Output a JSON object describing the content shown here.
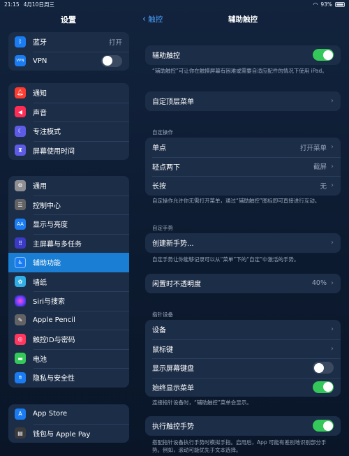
{
  "status": {
    "time": "21:15",
    "date": "4月10日周三",
    "battery": "93%"
  },
  "sidebar": {
    "title": "设置",
    "group1": [
      {
        "label": "蓝牙",
        "value": "打开",
        "icon": "bluetooth-icon",
        "color": "#1a7cf2"
      },
      {
        "label": "VPN",
        "icon": "vpn-icon",
        "color": "#1a7cf2",
        "toggle": false
      }
    ],
    "group2": [
      {
        "label": "通知",
        "icon": "bell-icon",
        "color": "#ff3b30"
      },
      {
        "label": "声音",
        "icon": "speaker-icon",
        "color": "#ff2d55"
      },
      {
        "label": "专注模式",
        "icon": "moon-icon",
        "color": "#5e5ce6"
      },
      {
        "label": "屏幕使用时间",
        "icon": "hourglass-icon",
        "color": "#5e5ce6"
      }
    ],
    "group3": [
      {
        "label": "通用",
        "icon": "gear-icon",
        "color": "#8e8e93"
      },
      {
        "label": "控制中心",
        "icon": "control-center-icon",
        "color": "#636366"
      },
      {
        "label": "显示与亮度",
        "icon": "text-size-icon",
        "color": "#1a7cf2"
      },
      {
        "label": "主屏幕与多任务",
        "icon": "grid-icon",
        "color": "#3a3ac6"
      },
      {
        "label": "辅助功能",
        "icon": "accessibility-icon",
        "color": "#1a7cf2",
        "selected": true
      },
      {
        "label": "墙纸",
        "icon": "flower-icon",
        "color": "#32ade6"
      },
      {
        "label": "Siri与搜索",
        "icon": "siri-icon",
        "color": "#222233"
      },
      {
        "label": "Apple Pencil",
        "icon": "pencil-icon",
        "color": "#636366"
      },
      {
        "label": "触控ID与密码",
        "icon": "fingerprint-icon",
        "color": "#ff375f"
      },
      {
        "label": "电池",
        "icon": "battery-icon",
        "color": "#34c759"
      },
      {
        "label": "隐私与安全性",
        "icon": "hand-icon",
        "color": "#1a7cf2"
      }
    ],
    "group4": [
      {
        "label": "App Store",
        "icon": "app-store-icon",
        "color": "#1a7cf2"
      },
      {
        "label": "钱包与 Apple Pay",
        "icon": "wallet-icon",
        "color": "#3a3a3c"
      }
    ]
  },
  "main": {
    "back_label": "触控",
    "title": "辅助触控",
    "assistive_touch_label": "辅助触控",
    "assistive_touch_note": "“辅助触控”可让你在触摸屏幕有困难或需要自适应配件的情况下使用 iPad。",
    "custom_top_menu": "自定顶层菜单",
    "custom_actions_header": "自定操作",
    "actions": [
      {
        "label": "单点",
        "value": "打开菜单"
      },
      {
        "label": "轻点两下",
        "value": "截屏"
      },
      {
        "label": "长按",
        "value": "无"
      }
    ],
    "actions_note": "自定操作允许你无需打开菜单，通过“辅助触控”图标即可直接进行互动。",
    "custom_gestures_header": "自定手势",
    "create_gesture": "创建新手势...",
    "gestures_note": "自定手势让你能够记录可以从“菜单”下的“自定”中激活的手势。",
    "idle_opacity_label": "闲置时不透明度",
    "idle_opacity_value": "40%",
    "pointer_header": "指针设备",
    "pointer_rows": [
      {
        "label": "设备"
      },
      {
        "label": "鼠标键"
      },
      {
        "label": "显示屏幕键盘",
        "toggle": false
      },
      {
        "label": "始终显示菜单",
        "toggle": true
      }
    ],
    "pointer_note": "连接指针设备时，“辅助触控”菜单会显示。",
    "dwell_label": "执行触控手势",
    "dwell_note": "搭配指针设备执行手势时模拟手指。启用后，App 可能有差别地识别部分手势。例如，滚动可能优先于文本选择。"
  }
}
